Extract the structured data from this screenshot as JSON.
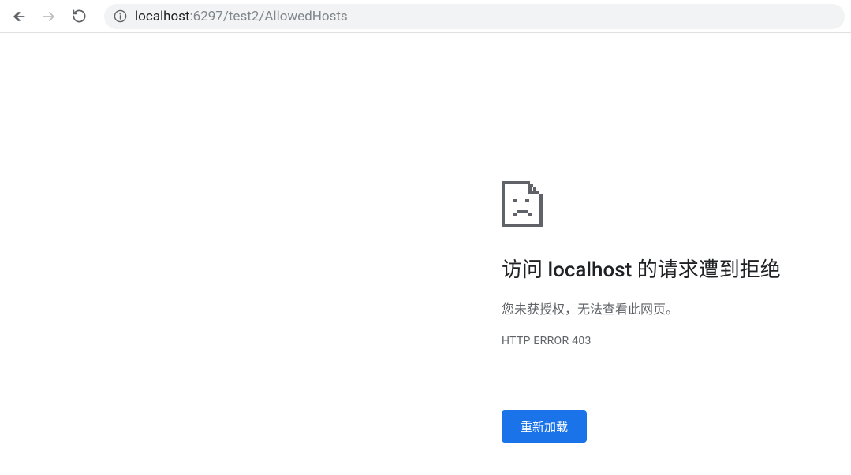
{
  "toolbar": {
    "url_host": "localhost",
    "url_rest": ":6297/test2/AllowedHosts"
  },
  "error": {
    "title_prefix": "访问 ",
    "title_host": "localhost",
    "title_suffix": " 的请求遭到拒绝",
    "description": "您未获授权，无法查看此网页。",
    "code": "HTTP ERROR 403",
    "reload_label": "重新加载"
  }
}
